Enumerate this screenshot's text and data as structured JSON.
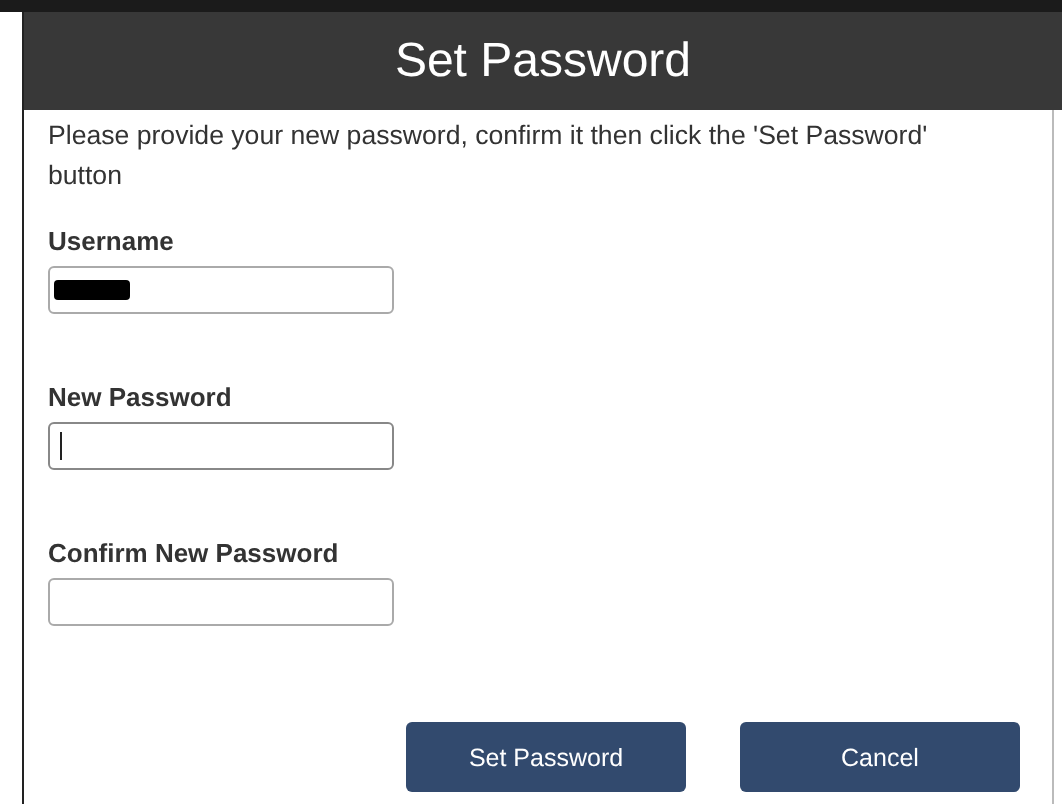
{
  "dialog": {
    "title": "Set Password",
    "instructions": "Please provide your new password, confirm it then click the 'Set Password' button"
  },
  "fields": [
    {
      "label": "Username",
      "redacted": true,
      "focused": false
    },
    {
      "label": "New Password",
      "redacted": false,
      "focused": true
    },
    {
      "label": "Confirm New Password",
      "redacted": false,
      "focused": false
    }
  ],
  "buttons": [
    "Set Password",
    "Cancel"
  ]
}
